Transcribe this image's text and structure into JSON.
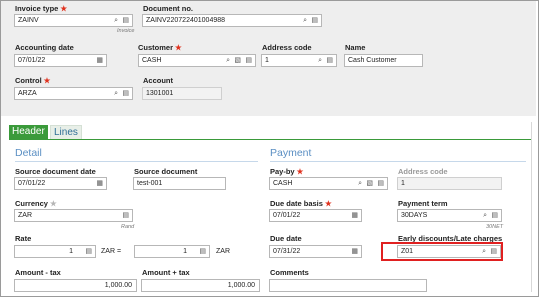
{
  "top": {
    "invoice_type": {
      "label": "Invoice type",
      "value": "ZAINV",
      "sub": "Invoice"
    },
    "document_no": {
      "label": "Document no.",
      "value": "ZAINV220722401004988"
    },
    "accounting_date": {
      "label": "Accounting date",
      "value": "07/01/22"
    },
    "customer": {
      "label": "Customer",
      "value": "CASH"
    },
    "address_code": {
      "label": "Address code",
      "value": "1"
    },
    "name": {
      "label": "Name",
      "value": "Cash Customer"
    },
    "control": {
      "label": "Control",
      "value": "ARZA"
    },
    "account": {
      "label": "Account",
      "value": "1301001"
    }
  },
  "tabs": {
    "header": "Header",
    "lines": "Lines"
  },
  "detail": {
    "title": "Detail",
    "source_document_date": {
      "label": "Source document date",
      "value": "07/01/22"
    },
    "source_document": {
      "label": "Source document",
      "value": "test-001"
    },
    "currency": {
      "label": "Currency",
      "value": "ZAR",
      "sub": "Rand"
    },
    "rate": {
      "label": "Rate",
      "value_left": "1",
      "middle": "ZAR =",
      "value_right": "1",
      "unit": "ZAR"
    },
    "amount_tax": {
      "label": "Amount - tax",
      "value": "1,000.00"
    },
    "amount_plus_tax": {
      "label": "Amount + tax",
      "value": "1,000.00"
    }
  },
  "payment": {
    "title": "Payment",
    "pay_by": {
      "label": "Pay-by",
      "value": "CASH"
    },
    "address_code": {
      "label": "Address code",
      "value": "1"
    },
    "due_date_basis": {
      "label": "Due date basis",
      "value": "07/01/22"
    },
    "payment_term": {
      "label": "Payment term",
      "value": "30DAYS",
      "sub": "30NET"
    },
    "due_date": {
      "label": "Due date",
      "value": "07/31/22"
    },
    "early_discounts": {
      "label": "Early discounts/Late charges",
      "value": "Z01"
    },
    "comments": {
      "label": "Comments",
      "value": ""
    }
  },
  "icons": {
    "search": "⌕",
    "list": "▤",
    "calendar": "▦",
    "link": "▧"
  },
  "colors": {
    "required": "#e0321e",
    "accent": "#3a9a3a",
    "section": "#5b8fc3",
    "highlight": "#e02020"
  }
}
